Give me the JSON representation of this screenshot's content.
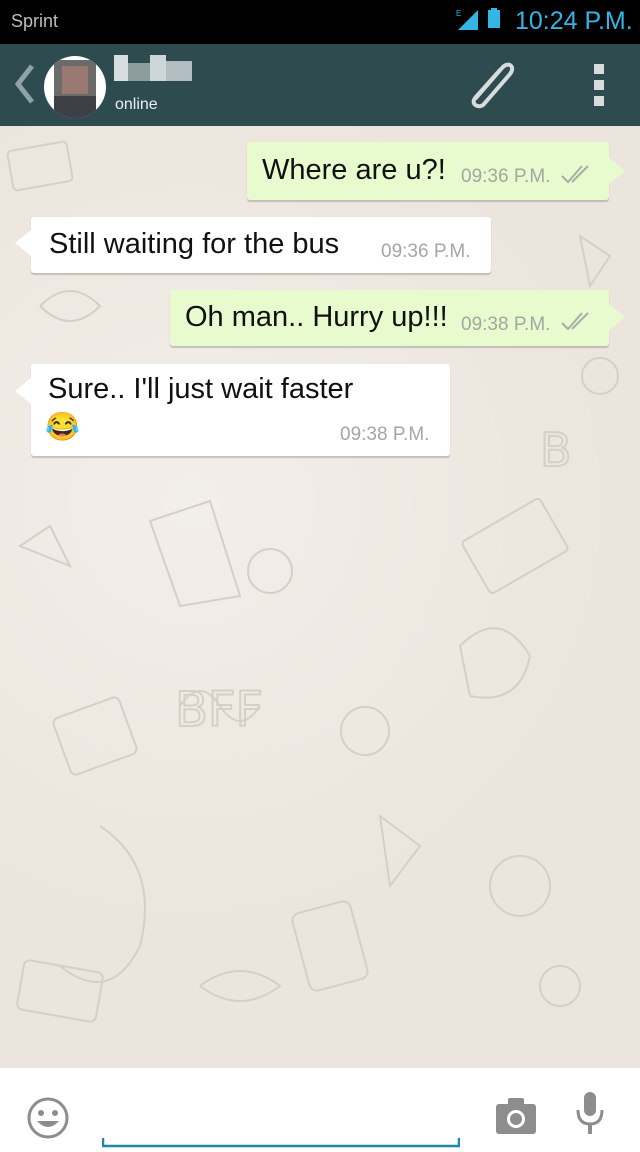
{
  "status_bar": {
    "carrier": "Sprint",
    "network_type": "E",
    "time": "10:24 P.M.",
    "clock_color": "#33b5e5"
  },
  "header": {
    "contact_status": "online",
    "background_color": "#2e4c50",
    "icons": [
      "back-chevron-icon",
      "paperclip-icon",
      "overflow-menu-icon"
    ]
  },
  "messages": [
    {
      "direction": "outgoing",
      "text": "Where are u?!",
      "time": "09:36 P.M.",
      "ticks": "double"
    },
    {
      "direction": "incoming",
      "text": "Still waiting for the bus",
      "time": "09:36 P.M."
    },
    {
      "direction": "outgoing",
      "text": "Oh man.. Hurry up!!!",
      "time": "09:38 P.M.",
      "ticks": "double"
    },
    {
      "direction": "incoming",
      "text": "Sure.. I'll just wait faster",
      "emoji": "😂",
      "time": "09:38 P.M."
    }
  ],
  "input_bar": {
    "icons": [
      "emoji-icon",
      "camera-icon",
      "microphone-icon"
    ],
    "accent_color": "#1e88a8"
  }
}
